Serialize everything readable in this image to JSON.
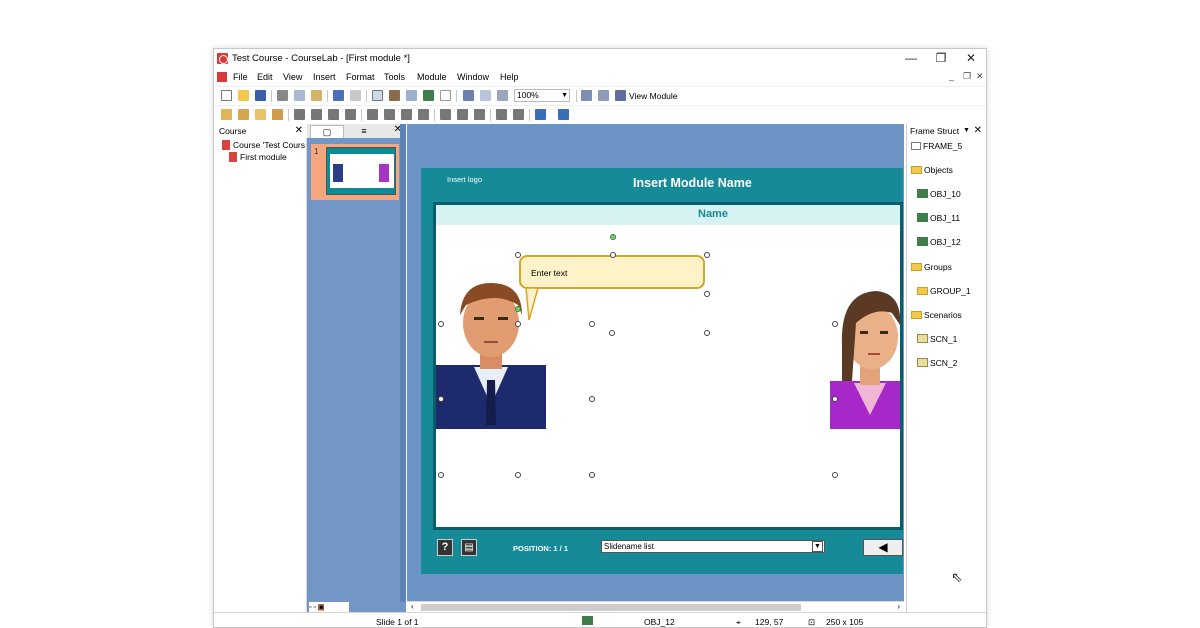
{
  "window": {
    "title": "Test Course - CourseLab - [First module *]"
  },
  "menu": [
    "File",
    "Edit",
    "View",
    "Insert",
    "Format",
    "Tools",
    "Module",
    "Window",
    "Help"
  ],
  "menu_underline": [
    "F",
    "E",
    "V",
    "I",
    "o",
    "T",
    "M",
    "W",
    "H"
  ],
  "toolbar": {
    "zoom": "100%",
    "view_module": "View Module"
  },
  "course_panel": {
    "title": "Course",
    "items": [
      "Course 'Test Cours",
      "First module"
    ]
  },
  "slides_panel": {
    "slide_number": "1"
  },
  "slide": {
    "logo": "Insert logo",
    "module_name": "Insert Module Name",
    "bubble_text": "Enter text",
    "name_fragment": "Name",
    "position_label": "POSITION: 1 / 1",
    "slidename_list": "Slidename list"
  },
  "frame_structure": {
    "title": "Frame Struct",
    "items": [
      "FRAME_5",
      "Objects",
      "OBJ_10",
      "OBJ_11",
      "OBJ_12",
      "Groups",
      "GROUP_1",
      "Scenarios",
      "SCN_1",
      "SCN_2"
    ]
  },
  "status": {
    "slide": "Slide 1 of 1",
    "object": "OBJ_12",
    "position": "129, 57",
    "size": "250 x 105"
  },
  "colors": {
    "canvas_bg": "#6b93c4",
    "slide_teal": "#178a98",
    "bubble_fill": "#fdf3c8",
    "bubble_border": "#d7a425"
  }
}
